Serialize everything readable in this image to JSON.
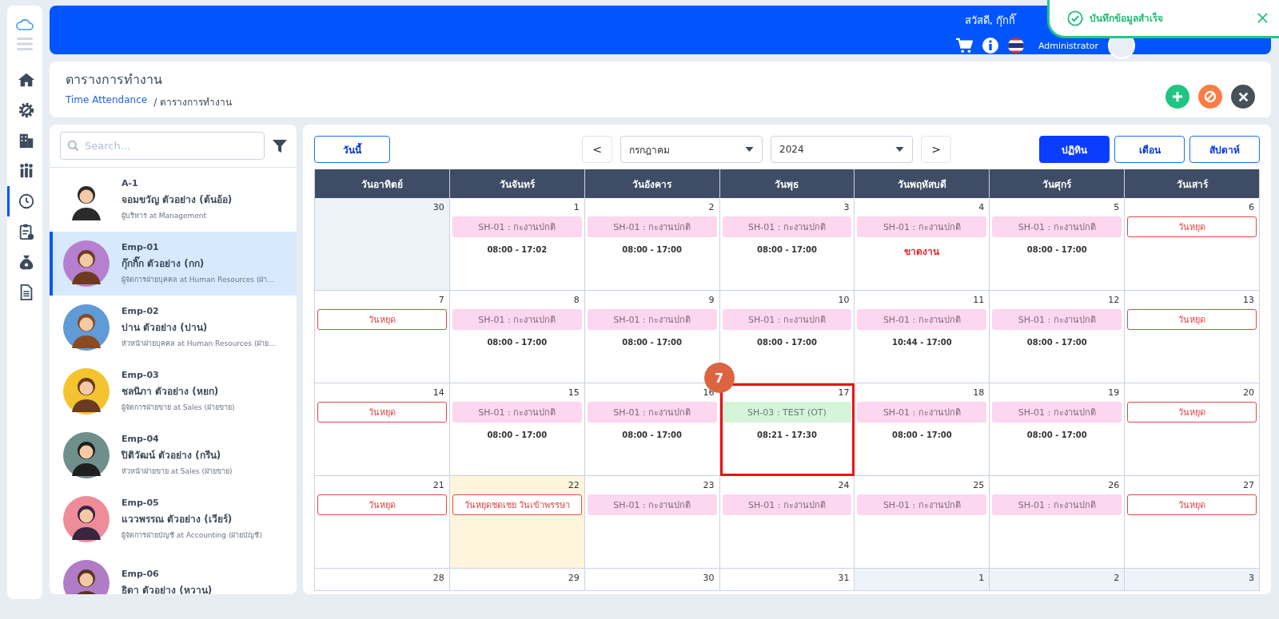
{
  "sidebar": {
    "items": [
      {
        "selected": false
      },
      {
        "selected": false
      },
      {
        "selected": false
      },
      {
        "selected": false
      },
      {
        "selected": true
      },
      {
        "selected": false
      },
      {
        "selected": false
      },
      {
        "selected": false
      }
    ]
  },
  "header": {
    "greeting": "สวัสดี, กุ๊กกิ๊",
    "role": "Administrator"
  },
  "toast": {
    "message": "บันทึกข้อมูลสำเร็จ"
  },
  "page": {
    "title": "ตารางการทำงาน",
    "breadcrumb": [
      {
        "label": "Time Attendance",
        "link": true
      },
      {
        "label": "/ ตารางการทำงาน",
        "link": false
      }
    ]
  },
  "employee_list": {
    "search": {
      "placeholder": "Search..."
    },
    "items": [
      {
        "code": "A-1",
        "name": "จอมขวัญ ตัวอย่าง (ต้นอ้อ)",
        "role": "ผู้บริหาร at Management",
        "selected": false
      },
      {
        "code": "Emp-01",
        "name": "กุ๊กกิ๊ก ตัวอย่าง (กก)",
        "role": "ผู้จัดการฝ่ายบุคคล at Human Resources (ฝ่า...",
        "selected": true
      },
      {
        "code": "Emp-02",
        "name": "ปาน ตัวอย่าง (ปาน)",
        "role": "หัวหน้าฝ่ายบุคคล at Human Resources (ฝ่าย...",
        "selected": false
      },
      {
        "code": "Emp-03",
        "name": "ชลนิภา ตัวอย่าง (หยก)",
        "role": "ผู้จัดการฝ่ายขาย at Sales (ฝ่ายขาย)",
        "selected": false
      },
      {
        "code": "Emp-04",
        "name": "ปิติวัฒน์ ตัวอย่าง (กรีน)",
        "role": "หัวหน้าฝ่ายขาย at Sales (ฝ่ายขาย)",
        "selected": false
      },
      {
        "code": "Emp-05",
        "name": "แววพรรณ ตัวอย่าง (เวียร์)",
        "role": "ผู้จัดการฝ่ายบัญชี at Accounting (ฝ่ายบัญชี)",
        "selected": false
      },
      {
        "code": "Emp-06",
        "name": "ธิดา ตัวอย่าง (หวาน)",
        "selected": false
      }
    ]
  },
  "calendar": {
    "today_button": "วันนี้",
    "prev": "<",
    "next": ">",
    "month": "กรกฎาคม",
    "year": "2024",
    "views": [
      {
        "label": "ปฏิทิน",
        "selected": true
      },
      {
        "label": "เดือน",
        "selected": false
      },
      {
        "label": "สัปดาห์",
        "selected": false
      }
    ],
    "weekdays": [
      "วันอาทิตย์",
      "วันจันทร์",
      "วันอังคาร",
      "วันพุธ",
      "วันพฤหัสบดี",
      "วันศุกร์",
      "วันเสาร์"
    ],
    "callout": {
      "label": "7"
    },
    "weeks": [
      [
        {
          "day": "30",
          "outside": true,
          "today": false,
          "highlighted": false
        },
        {
          "day": "1",
          "outside": false,
          "today": false,
          "highlighted": false,
          "lines": [
            {
              "kind": "shift",
              "text": "SH-01 : กะงานปกติ",
              "color": "#fdd6ef"
            },
            {
              "kind": "time",
              "text": "08:00 - 17:02"
            }
          ]
        },
        {
          "day": "2",
          "outside": false,
          "today": false,
          "highlighted": false,
          "lines": [
            {
              "kind": "shift",
              "text": "SH-01 : กะงานปกติ",
              "color": "#fdd6ef"
            },
            {
              "kind": "time",
              "text": "08:00 - 17:00"
            }
          ]
        },
        {
          "day": "3",
          "outside": false,
          "today": false,
          "highlighted": false,
          "lines": [
            {
              "kind": "shift",
              "text": "SH-01 : กะงานปกติ",
              "color": "#fdd6ef"
            },
            {
              "kind": "time",
              "text": "08:00 - 17:00"
            }
          ]
        },
        {
          "day": "4",
          "outside": false,
          "today": false,
          "highlighted": false,
          "lines": [
            {
              "kind": "shift",
              "text": "SH-01 : กะงานปกติ",
              "color": "#fdd6ef"
            },
            {
              "kind": "absent",
              "text": "ขาดงาน"
            }
          ]
        },
        {
          "day": "5",
          "outside": false,
          "today": false,
          "highlighted": false,
          "lines": [
            {
              "kind": "shift",
              "text": "SH-01 : กะงานปกติ",
              "color": "#fdd6ef"
            },
            {
              "kind": "time",
              "text": "08:00 - 17:00"
            }
          ]
        },
        {
          "day": "6",
          "outside": false,
          "today": false,
          "highlighted": false,
          "lines": [
            {
              "kind": "holiday",
              "text": "วันหยุด"
            }
          ]
        }
      ],
      [
        {
          "day": "7",
          "outside": false,
          "today": false,
          "highlighted": false,
          "lines": [
            {
              "kind": "holiday",
              "text": "วันหยุด"
            }
          ]
        },
        {
          "day": "8",
          "outside": false,
          "today": false,
          "highlighted": false,
          "lines": [
            {
              "kind": "shift",
              "text": "SH-01 : กะงานปกติ",
              "color": "#fdd6ef"
            },
            {
              "kind": "time",
              "text": "08:00 - 17:00"
            }
          ]
        },
        {
          "day": "9",
          "outside": false,
          "today": false,
          "highlighted": false,
          "lines": [
            {
              "kind": "shift",
              "text": "SH-01 : กะงานปกติ",
              "color": "#fdd6ef"
            },
            {
              "kind": "time",
              "text": "08:00 - 17:00"
            }
          ]
        },
        {
          "day": "10",
          "outside": false,
          "today": false,
          "highlighted": false,
          "lines": [
            {
              "kind": "shift",
              "text": "SH-01 : กะงานปกติ",
              "color": "#fdd6ef"
            },
            {
              "kind": "time",
              "text": "08:00 - 17:00"
            }
          ]
        },
        {
          "day": "11",
          "outside": false,
          "today": false,
          "highlighted": false,
          "lines": [
            {
              "kind": "shift",
              "text": "SH-01 : กะงานปกติ",
              "color": "#fdd6ef"
            },
            {
              "kind": "time",
              "text": "10:44 - 17:00"
            }
          ]
        },
        {
          "day": "12",
          "outside": false,
          "today": false,
          "highlighted": false,
          "lines": [
            {
              "kind": "shift",
              "text": "SH-01 : กะงานปกติ",
              "color": "#fdd6ef"
            },
            {
              "kind": "time",
              "text": "08:00 - 17:00"
            }
          ]
        },
        {
          "day": "13",
          "outside": false,
          "today": false,
          "highlighted": false,
          "lines": [
            {
              "kind": "holiday",
              "text": "วันหยุด"
            }
          ]
        }
      ],
      [
        {
          "day": "14",
          "outside": false,
          "today": false,
          "highlighted": false,
          "lines": [
            {
              "kind": "holiday",
              "text": "วันหยุด"
            }
          ]
        },
        {
          "day": "15",
          "outside": false,
          "today": false,
          "highlighted": false,
          "lines": [
            {
              "kind": "shift",
              "text": "SH-01 : กะงานปกติ",
              "color": "#fdd6ef"
            },
            {
              "kind": "time",
              "text": "08:00 - 17:00"
            }
          ]
        },
        {
          "day": "16",
          "outside": false,
          "today": false,
          "highlighted": false,
          "lines": [
            {
              "kind": "shift",
              "text": "SH-01 : กะงานปกติ",
              "color": "#fdd6ef"
            },
            {
              "kind": "time",
              "text": "08:00 - 17:00"
            }
          ]
        },
        {
          "day": "17",
          "outside": false,
          "today": false,
          "highlighted": true,
          "lines": [
            {
              "kind": "shift",
              "text": "SH-03 : TEST (OT)",
              "color": "#d4f5da"
            },
            {
              "kind": "time",
              "text": "08:21 - 17:30"
            }
          ]
        },
        {
          "day": "18",
          "outside": false,
          "today": false,
          "highlighted": false,
          "lines": [
            {
              "kind": "shift",
              "text": "SH-01 : กะงานปกติ",
              "color": "#fdd6ef"
            },
            {
              "kind": "time",
              "text": "08:00 - 17:00"
            }
          ]
        },
        {
          "day": "19",
          "outside": false,
          "today": false,
          "highlighted": false,
          "lines": [
            {
              "kind": "shift",
              "text": "SH-01 : กะงานปกติ",
              "color": "#fdd6ef"
            },
            {
              "kind": "time",
              "text": "08:00 - 17:00"
            }
          ]
        },
        {
          "day": "20",
          "outside": false,
          "today": false,
          "highlighted": false,
          "lines": [
            {
              "kind": "holiday",
              "text": "วันหยุด"
            }
          ]
        }
      ],
      [
        {
          "day": "21",
          "outside": false,
          "today": false,
          "highlighted": false,
          "lines": [
            {
              "kind": "holiday",
              "text": "วันหยุด"
            }
          ]
        },
        {
          "day": "22",
          "outside": false,
          "today": true,
          "highlighted": false,
          "lines": [
            {
              "kind": "holiday",
              "text": "วันหยุดชดเชย วันเข้าพรรษา"
            }
          ]
        },
        {
          "day": "23",
          "outside": false,
          "today": false,
          "highlighted": false,
          "lines": [
            {
              "kind": "shift",
              "text": "SH-01 : กะงานปกติ",
              "color": "#fdd6ef"
            }
          ]
        },
        {
          "day": "24",
          "outside": false,
          "today": false,
          "highlighted": false,
          "lines": [
            {
              "kind": "shift",
              "text": "SH-01 : กะงานปกติ",
              "color": "#fdd6ef"
            }
          ]
        },
        {
          "day": "25",
          "outside": false,
          "today": false,
          "highlighted": false,
          "lines": [
            {
              "kind": "shift",
              "text": "SH-01 : กะงานปกติ",
              "color": "#fdd6ef"
            }
          ]
        },
        {
          "day": "26",
          "outside": false,
          "today": false,
          "highlighted": false,
          "lines": [
            {
              "kind": "shift",
              "text": "SH-01 : กะงานปกติ",
              "color": "#fdd6ef"
            }
          ]
        },
        {
          "day": "27",
          "outside": false,
          "today": false,
          "highlighted": false,
          "lines": [
            {
              "kind": "holiday",
              "text": "วันหยุด"
            }
          ]
        }
      ],
      [
        {
          "day": "28",
          "outside": false,
          "today": false,
          "highlighted": false
        },
        {
          "day": "29",
          "outside": false,
          "today": false,
          "highlighted": false
        },
        {
          "day": "30",
          "outside": false,
          "today": false,
          "highlighted": false
        },
        {
          "day": "31",
          "outside": false,
          "today": false,
          "highlighted": false
        },
        {
          "day": "1",
          "outside": true,
          "today": false,
          "highlighted": false
        },
        {
          "day": "2",
          "outside": true,
          "today": false,
          "highlighted": false
        },
        {
          "day": "3",
          "outside": true,
          "today": false,
          "highlighted": false
        }
      ]
    ]
  }
}
